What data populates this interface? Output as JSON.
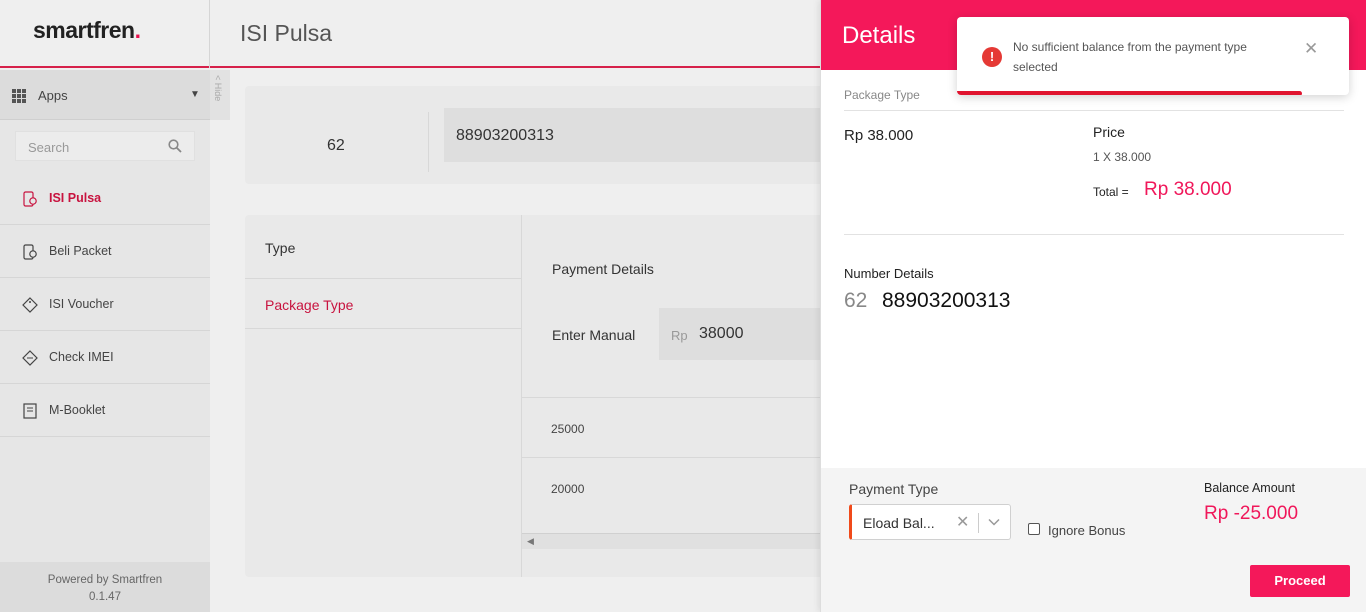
{
  "app": {
    "logo_text": "smartfren",
    "logo_dot": ".",
    "page_title": "ISI Pulsa"
  },
  "sidebar": {
    "apps_label": "Apps",
    "hide_label": "< Hide",
    "search_placeholder": "Search",
    "items": [
      {
        "label": "ISI Pulsa",
        "icon": "pulsa-icon",
        "active": true
      },
      {
        "label": "Beli Packet",
        "icon": "packet-icon",
        "active": false
      },
      {
        "label": "ISI Voucher",
        "icon": "voucher-icon",
        "active": false
      },
      {
        "label": "Check IMEI",
        "icon": "tag-icon",
        "active": false
      },
      {
        "label": "M-Booklet",
        "icon": "booklet-icon",
        "active": false
      }
    ],
    "powered_by": "Powered by Smartfren",
    "version": "0.1.47"
  },
  "phone_card": {
    "country_code": "62",
    "number": "88903200313"
  },
  "main_card": {
    "type_label": "Type",
    "package_type_label": "Package Type",
    "payment_details_label": "Payment Details",
    "enter_manual_label": "Enter Manual",
    "currency_prefix": "Rp",
    "manual_amount": "38000",
    "rows": [
      "25000",
      "20000"
    ]
  },
  "details": {
    "title": "Details",
    "package_type_label": "Package Type",
    "package_price": "Rp 38.000",
    "price_label": "Price",
    "price_qty": "1 X 38.000",
    "total_label": "Total =",
    "total_value": "Rp 38.000",
    "number_details_label": "Number Details",
    "number_cc": "62",
    "number_value": "88903200313",
    "payment_type_label": "Payment Type",
    "payment_type_value": "Eload Bal...",
    "ignore_bonus_label": "Ignore Bonus",
    "balance_amount_label": "Balance Amount",
    "balance_amount_value": "Rp -25.000",
    "proceed_label": "Proceed"
  },
  "toast": {
    "message": "No sufficient balance from the payment type selected",
    "icon": "!"
  },
  "colors": {
    "brand": "#f4185a",
    "accent_red": "#c8133f",
    "error": "#e53935"
  }
}
